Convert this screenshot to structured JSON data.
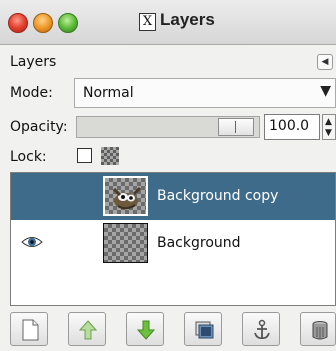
{
  "window": {
    "x_badge": "X",
    "title": "Layers"
  },
  "dock": {
    "title": "Layers",
    "menu_icon": "tab-menu-arrow-icon"
  },
  "mode": {
    "label": "Mode:",
    "value": "Normal"
  },
  "opacity": {
    "label": "Opacity:",
    "value": "100.0",
    "percent": 100
  },
  "lock": {
    "label": "Lock:"
  },
  "layers": [
    {
      "name": "Background copy",
      "selected": true,
      "visible": false
    },
    {
      "name": "Background",
      "selected": false,
      "visible": true
    }
  ],
  "toolbar": {
    "buttons": [
      "new-layer-icon",
      "raise-layer-icon",
      "lower-layer-icon",
      "duplicate-layer-icon",
      "anchor-layer-icon",
      "delete-layer-icon"
    ]
  },
  "colors": {
    "selection": "#3f6b8b",
    "arrow_green": "#6fbf3e"
  }
}
